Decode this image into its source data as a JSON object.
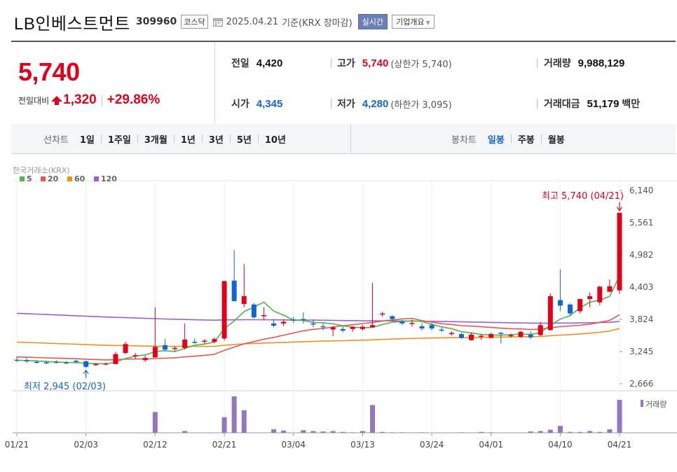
{
  "header": {
    "name": "LB인베스트먼트",
    "code": "309960",
    "market": "코스닥",
    "date": "2025.04.21",
    "basis": "기준(KRX 장마감)",
    "realtime_label": "실시간",
    "company_label": "기업개요"
  },
  "quote": {
    "price": "5,740",
    "change_label": "전일대비",
    "change": "1,320",
    "rate": "+29.86%",
    "prev_close_label": "전일",
    "prev_close": "4,420",
    "high_label": "고가",
    "high": "5,740",
    "upper_limit": "(상한가 5,740)",
    "volume_label": "거래량",
    "volume": "9,988,129",
    "open_label": "시가",
    "open": "4,345",
    "low_label": "저가",
    "low": "4,280",
    "lower_limit": "(하한가 3,095)",
    "value_label": "거래대금",
    "value": "51,179",
    "value_unit": "백만"
  },
  "colors": {
    "up": "#e3001b",
    "down": "#1266d3",
    "ma5": "#4cb648",
    "ma20": "#ef5350",
    "ma60": "#f28f1c",
    "ma120": "#9a61cc",
    "volume": "#9476bf"
  },
  "tabs": {
    "line_label": "선차트",
    "line_items": [
      "1일",
      "1주일",
      "3개월",
      "1년",
      "3년",
      "5년",
      "10년"
    ],
    "candle_label": "봉차트",
    "candle_items": [
      "일봉",
      "주봉",
      "월봉"
    ],
    "candle_selected": "일봉"
  },
  "chart_data": {
    "type": "candlestick",
    "source_label": "한국거래소(KRX)",
    "legend": [
      {
        "name": "5",
        "color": "#4cb648"
      },
      {
        "name": "20",
        "color": "#ef5350"
      },
      {
        "name": "60",
        "color": "#f28f1c"
      },
      {
        "name": "120",
        "color": "#9a61cc"
      }
    ],
    "y_ticks": [
      6140,
      5561,
      4982,
      4403,
      3824,
      3245,
      2666
    ],
    "y_tick_labels": [
      "6,140",
      "5,561",
      "4,982",
      "4,403",
      "3,824",
      "3,245",
      "2,666"
    ],
    "ylim": [
      2666,
      6140
    ],
    "x_tick_labels": [
      {
        "i": 0,
        "label": "01/21"
      },
      {
        "i": 7,
        "label": "02/03"
      },
      {
        "i": 14,
        "label": "02/12"
      },
      {
        "i": 21,
        "label": "02/21"
      },
      {
        "i": 28,
        "label": "03/04"
      },
      {
        "i": 35,
        "label": "03/13"
      },
      {
        "i": 42,
        "label": "03/24"
      },
      {
        "i": 48,
        "label": "04/01"
      },
      {
        "i": 55,
        "label": "04/10"
      },
      {
        "i": 61,
        "label": "04/21"
      }
    ],
    "high_annotation": "최고 5,740 (04/21)",
    "low_annotation": "최저 2,945 (02/03)",
    "volume_label": "거래량",
    "candles": [
      [
        3098,
        3160,
        3060,
        3080
      ],
      [
        3090,
        3130,
        3040,
        3070
      ],
      [
        3060,
        3090,
        3030,
        3050
      ],
      [
        3050,
        3080,
        3020,
        3040
      ],
      [
        3060,
        3090,
        3030,
        3050
      ],
      [
        3050,
        3070,
        3020,
        3040
      ],
      [
        3080,
        3100,
        3030,
        3060
      ],
      [
        3070,
        3080,
        2945,
        2970
      ],
      [
        3000,
        3040,
        2990,
        3020
      ],
      [
        3020,
        3050,
        3000,
        3030
      ],
      [
        3020,
        3240,
        3020,
        3200
      ],
      [
        3220,
        3420,
        3200,
        3380
      ],
      [
        3160,
        3220,
        3120,
        3180
      ],
      [
        3090,
        3170,
        3060,
        3130
      ],
      [
        3140,
        4040,
        3130,
        3330
      ],
      [
        3360,
        3470,
        3250,
        3280
      ],
      [
        3290,
        3340,
        3250,
        3310
      ],
      [
        3310,
        3750,
        3280,
        3460
      ],
      [
        3420,
        3480,
        3380,
        3410
      ],
      [
        3420,
        3470,
        3380,
        3440
      ],
      [
        3420,
        3500,
        3390,
        3470
      ],
      [
        3480,
        4520,
        3440,
        4510
      ],
      [
        4520,
        5070,
        4350,
        4150
      ],
      [
        4100,
        4820,
        4040,
        4240
      ],
      [
        4090,
        4120,
        3840,
        3860
      ],
      [
        3880,
        4040,
        3820,
        3900
      ],
      [
        3750,
        3830,
        3680,
        3710
      ],
      [
        3750,
        3830,
        3700,
        3780
      ],
      [
        3820,
        3870,
        3760,
        3800
      ],
      [
        3830,
        3950,
        3750,
        3820
      ],
      [
        3750,
        3820,
        3680,
        3730
      ],
      [
        3700,
        3750,
        3630,
        3690
      ],
      [
        3640,
        3700,
        3520,
        3680
      ],
      [
        3650,
        3700,
        3590,
        3620
      ],
      [
        3650,
        3700,
        3600,
        3690
      ],
      [
        3650,
        3720,
        3620,
        3690
      ],
      [
        3680,
        4480,
        3670,
        3720
      ],
      [
        3920,
        3960,
        3870,
        3930
      ],
      [
        3880,
        3900,
        3800,
        3830
      ],
      [
        3780,
        3810,
        3720,
        3750
      ],
      [
        3750,
        3820,
        3690,
        3760
      ],
      [
        3700,
        3760,
        3620,
        3660
      ],
      [
        3720,
        3760,
        3620,
        3660
      ],
      [
        3640,
        3690,
        3600,
        3620
      ],
      [
        3560,
        3610,
        3530,
        3580
      ],
      [
        3560,
        3580,
        3470,
        3490
      ],
      [
        3450,
        3590,
        3440,
        3550
      ],
      [
        3510,
        3560,
        3460,
        3530
      ],
      [
        3490,
        3580,
        3480,
        3560
      ],
      [
        3580,
        3600,
        3390,
        3560
      ],
      [
        3520,
        3570,
        3500,
        3540
      ],
      [
        3510,
        3620,
        3490,
        3600
      ],
      [
        3550,
        3610,
        3470,
        3500
      ],
      [
        3540,
        3780,
        3520,
        3720
      ],
      [
        3630,
        4290,
        3620,
        4240
      ],
      [
        4170,
        4720,
        3970,
        4070
      ],
      [
        4090,
        4110,
        3880,
        3930
      ],
      [
        3970,
        4190,
        3930,
        4190
      ],
      [
        4190,
        4310,
        4040,
        4240
      ],
      [
        4130,
        4430,
        4080,
        4410
      ],
      [
        4320,
        4540,
        4310,
        4420
      ],
      [
        4345,
        5740,
        4280,
        5740
      ]
    ],
    "volumes": [
      0,
      0,
      0,
      0,
      0,
      0,
      0,
      0,
      0,
      0,
      0,
      0,
      0,
      0,
      240,
      0,
      0,
      20,
      0,
      0,
      0,
      180,
      420,
      260,
      0,
      0,
      40,
      25,
      0,
      30,
      20,
      15,
      20,
      10,
      5,
      20,
      320,
      10,
      5,
      5,
      0,
      5,
      0,
      0,
      0,
      5,
      0,
      10,
      5,
      0,
      0,
      0,
      15,
      20,
      35,
      80,
      10,
      10,
      20,
      10,
      40,
      380
    ]
  }
}
